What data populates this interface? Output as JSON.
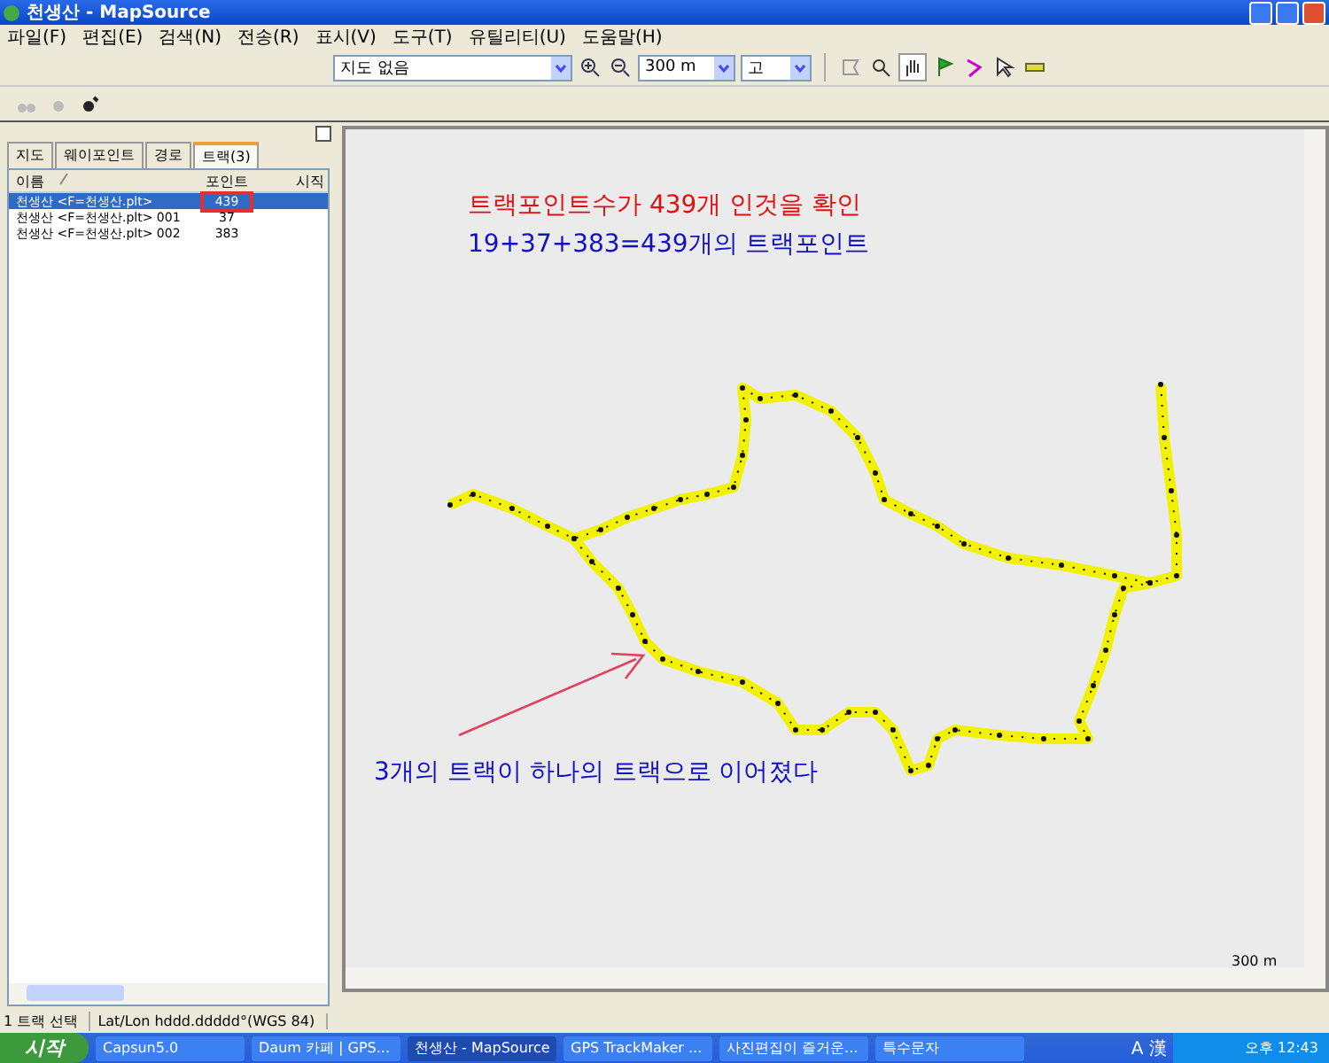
{
  "window": {
    "title": "천생산 - MapSource"
  },
  "menu": [
    "파일(F)",
    "편집(E)",
    "검색(N)",
    "전송(R)",
    "표시(V)",
    "도구(T)",
    "유틸리티(U)",
    "도움말(H)"
  ],
  "toolbar": {
    "map_product": "지도 없음",
    "zoom_scale": "300 m",
    "detail": "고"
  },
  "tabs": [
    {
      "label": "지도",
      "selected": false
    },
    {
      "label": "웨이포인트",
      "selected": false
    },
    {
      "label": "경로",
      "selected": false
    },
    {
      "label": "트랙(3)",
      "selected": true
    }
  ],
  "table": {
    "columns": [
      "이름",
      "포인트",
      "시직"
    ],
    "rows": [
      {
        "name": "천생산 <F=천생산.plt>",
        "points": "439",
        "selected": true,
        "highlighted": true
      },
      {
        "name": "천생산 <F=천생산.plt> 001",
        "points": "37",
        "selected": false,
        "highlighted": false
      },
      {
        "name": "천생산 <F=천생산.plt> 002",
        "points": "383",
        "selected": false,
        "highlighted": false
      }
    ]
  },
  "map": {
    "annotations": [
      {
        "text": "트랙포인트수가 439개 인것을 확인",
        "color": "#e01010"
      },
      {
        "text": "19+37+383=439개의 트랙포인트",
        "color": "#1010c0"
      },
      {
        "text": "3개의 트랙이 하나의 트랙으로 이어졌다",
        "color": "#1010c0"
      }
    ],
    "scale_label": "300 m"
  },
  "status_bar": [
    "1 트랙 선택",
    "Lat/Lon hddd.ddddd°(WGS 84)"
  ],
  "taskbar": {
    "start": "시작",
    "tasks": [
      {
        "label": "Capsun5.0",
        "selected": false
      },
      {
        "label": "Daum 카페 | GPS...",
        "selected": false
      },
      {
        "label": "천생산 - MapSource",
        "selected": true
      },
      {
        "label": "GPS TrackMaker ...",
        "selected": false
      },
      {
        "label": "사진편집이 즐거운...",
        "selected": false
      },
      {
        "label": "특수문자",
        "selected": false
      }
    ],
    "ime": "A 漢",
    "clock": "오후 12:43"
  }
}
